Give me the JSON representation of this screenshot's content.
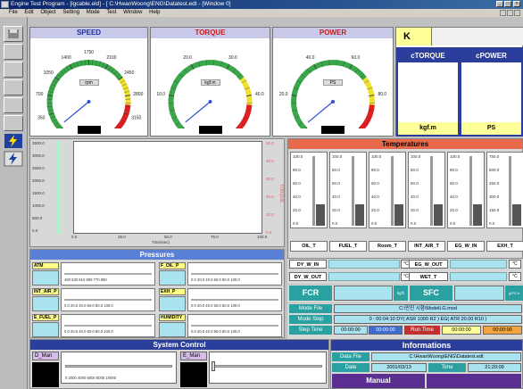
{
  "window": {
    "title": "Engine Test Program - [lgcable.eld] - [ C:\\HwanWoong\\ENG\\Datatest.edt - [Window 0]",
    "controls": [
      "_",
      "□",
      "×"
    ]
  },
  "menu": [
    "File",
    "Edit",
    "Object",
    "Setting",
    "Mode",
    "Test",
    "Window",
    "Help"
  ],
  "gauges": [
    {
      "title": "SPEED",
      "unit": "rpm",
      "ticks": [
        "0",
        "350",
        "700",
        "1050",
        "1400",
        "1750",
        "2100",
        "2450",
        "2800",
        "3150",
        "3500"
      ],
      "color": "#4040c0"
    },
    {
      "title": "TORQUE",
      "unit": "kgf.m",
      "ticks": [
        "0.0",
        "10.0",
        "20.0",
        "30.0",
        "40.0",
        "50.0"
      ],
      "color": "#4040c0"
    },
    {
      "title": "POWER",
      "unit": "PS",
      "ticks": [
        "0.0",
        "20.0",
        "40.0",
        "60.0",
        "80.0",
        "100.0"
      ],
      "color": "#4040c0"
    }
  ],
  "k_panel": {
    "k_label": "K",
    "ctorque_label": "cTORQUE",
    "cpower_label": "cPOWER",
    "ctorque_unit": "kgf.m",
    "cpower_unit": "PS"
  },
  "chart": {
    "xlabel": "Time(sec)",
    "x_ticks": [
      "0.0",
      "25.0",
      "50.0",
      "75.0",
      "100.0"
    ],
    "left_ticks": [
      "3500.0",
      "3000.0",
      "2500.0",
      "2000.0",
      "1500.0",
      "1000.0",
      "500.0",
      "0.0"
    ],
    "right_ticks": [
      "50.0",
      "40.0",
      "30.0",
      "20.0",
      "10.0",
      "0.0"
    ],
    "right_label": "TORQUE"
  },
  "temperatures": {
    "title": "Temperatures",
    "columns": [
      {
        "label": "OIL_T",
        "ticks": [
          "100.0",
          "80.0",
          "60.0",
          "40.0",
          "20.0",
          "0.0"
        ]
      },
      {
        "label": "FUEL_T",
        "ticks": [
          "100.0",
          "80.0",
          "60.0",
          "40.0",
          "20.0",
          "0.0"
        ]
      },
      {
        "label": "Room_T",
        "ticks": [
          "100.0",
          "80.0",
          "60.0",
          "40.0",
          "20.0",
          "0.0"
        ]
      },
      {
        "label": "INT_AIR_T",
        "ticks": [
          "100.0",
          "80.0",
          "60.0",
          "40.0",
          "20.0",
          "0.0"
        ]
      },
      {
        "label": "EG_W_IN",
        "ticks": [
          "100.0",
          "80.0",
          "60.0",
          "40.0",
          "20.0",
          "0.0"
        ]
      },
      {
        "label": "EXH_T",
        "ticks": [
          "750.0",
          "600.0",
          "450.0",
          "300.0",
          "150.0",
          "0.0"
        ]
      }
    ],
    "fields": [
      {
        "label": "DY_W_IN",
        "unit": "°C"
      },
      {
        "label": "EG_W_OUT",
        "unit": "°C"
      },
      {
        "label": "DY_W_OUT",
        "unit": "°C"
      },
      {
        "label": "WET_T",
        "unit": "°C"
      }
    ]
  },
  "pressures": {
    "title": "Pressures",
    "items": [
      {
        "label": "ATM",
        "scale": "460  530  610  690  770  850"
      },
      {
        "label": "F_OIL_P",
        "scale": "0.0  20.0  40.0  60.0  80.0 100.0"
      },
      {
        "label": "INT_AIR_P",
        "scale": "0.0  20.0  40.0  60.0  80.0 100.0"
      },
      {
        "label": "EXH_P",
        "scale": "0.0  20.0  40.0  60.0  80.0 100.0"
      },
      {
        "label": "E_FUEL_P",
        "scale": "0.0  20.0  40.0  60.0  80.0 100.0"
      },
      {
        "label": "HUMIDITY",
        "scale": "0.0  20.0  40.0  60.0  80.0 100.0"
      }
    ]
  },
  "fcr": {
    "label": "FCR",
    "unit": "kg/h",
    "sfc_label": "SFC",
    "sfc_unit": "g/PS.h"
  },
  "mode": {
    "mode_file_label": "Mode File",
    "mode_file_value": "C:\\만진 시험\\ModelLG.mod",
    "mode_step_label": "Mode Step",
    "mode_step_value": "0 : 00:04:10  DY( ASR 1000 R2 ) EG( ATR 20.00 R10 )",
    "step_time_label": "Step Time",
    "step_time_value": "00:00:00",
    "step_time_value2": "00:00:00",
    "run_time_label": "Run Time",
    "run_time_value": "00:00:00",
    "run_time_value2": "00:00:00"
  },
  "system_control": {
    "title": "System Control",
    "d_man": "D_Man",
    "e_man": "E_Man",
    "d_scale": "0     2000    4000    6000    8000 10000"
  },
  "informations": {
    "title": "Informations",
    "data_file_label": "Data File",
    "data_file_value": "C:\\HwanWoong\\ENG\\Datatest.edt",
    "date_label": "Date",
    "date_value": "2001/03/13",
    "time_label": "Time",
    "time_value": "21:20:09",
    "manual_label": "Manual"
  }
}
